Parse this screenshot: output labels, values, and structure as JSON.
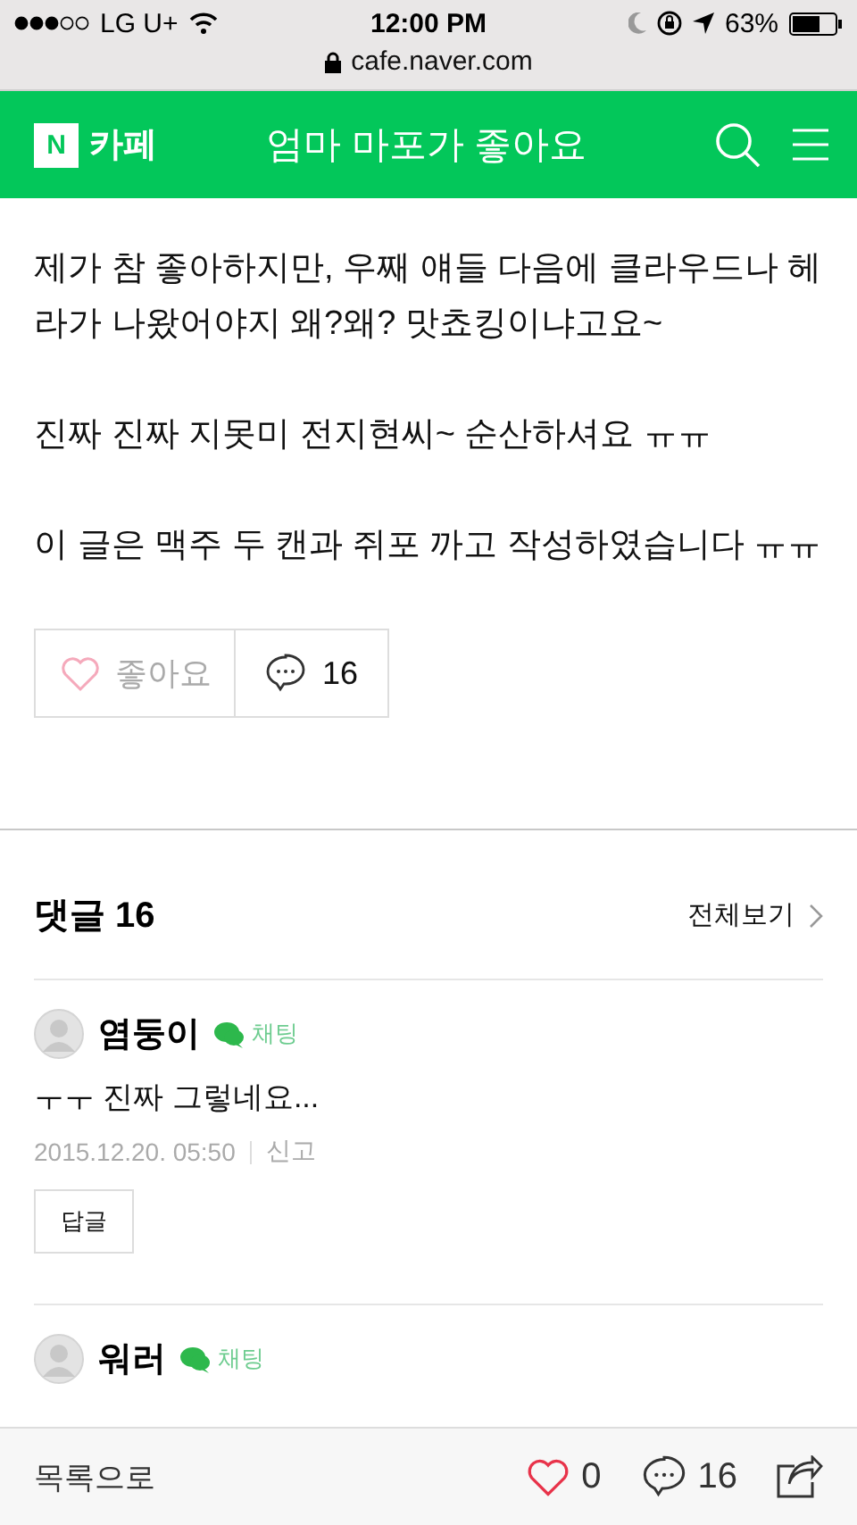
{
  "status_bar": {
    "carrier": "LG U+",
    "time": "12:00 PM",
    "battery": "63%",
    "url": "cafe.naver.com"
  },
  "header": {
    "logo_letter": "N",
    "logo_text": "카페",
    "title": "엄마 마포가 좋아요"
  },
  "post": {
    "paragraphs": [
      "제가 참 좋아하지만, 우째 얘들 다음에 클라우드나 헤라가 나왔어야지 왜?왜? 맛쵸킹이냐고요~",
      "진짜 진짜 지못미 전지현씨~ 순산하셔요 ㅠㅠ",
      "이 글은 맥주 두 캔과 쥐포 까고 작성하였습니다 ㅠㅠ"
    ],
    "like_label": "좋아요",
    "liked": false,
    "comment_count": "16"
  },
  "comments": {
    "title": "댓글 16",
    "view_all": "전체보기",
    "items": [
      {
        "author": "염둥이",
        "chat_label": "채팅",
        "text": "ㅜㅜ 진짜 그렇네요...",
        "date": "2015.12.20. 05:50",
        "report": "신고",
        "reply": "답글"
      },
      {
        "author": "워러",
        "chat_label": "채팅"
      }
    ]
  },
  "bottom_bar": {
    "list_label": "목록으로",
    "like_count": "0",
    "comment_count": "16"
  }
}
